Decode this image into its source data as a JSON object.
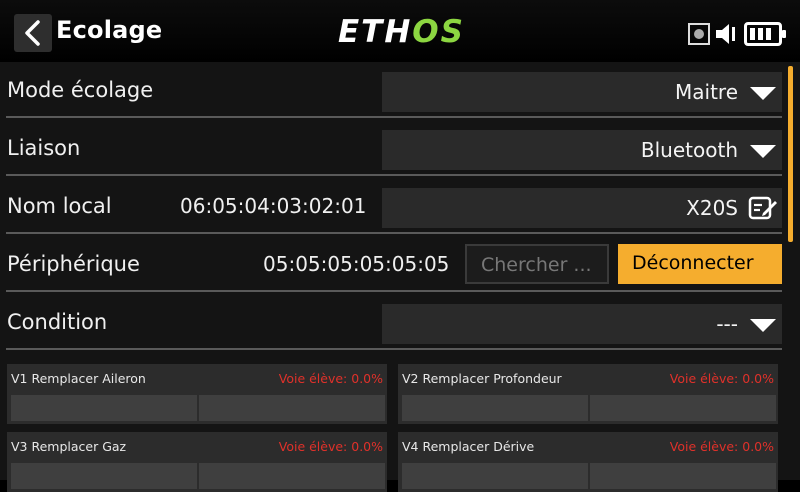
{
  "header": {
    "title": "Ecolage",
    "logo_part1": "ETH",
    "logo_part2": "OS"
  },
  "rows": {
    "mode": {
      "label": "Mode écolage",
      "value": "Maitre"
    },
    "link": {
      "label": "Liaison",
      "value": "Bluetooth"
    },
    "local_name": {
      "label": "Nom local",
      "address": "06:05:04:03:02:01",
      "value": "X20S"
    },
    "device": {
      "label": "Périphérique",
      "address": "05:05:05:05:05:05",
      "search_label": "Chercher ...",
      "disconnect_label": "Déconnecter"
    },
    "condition": {
      "label": "Condition",
      "value": "---"
    }
  },
  "channels": [
    {
      "label": "V1 Remplacer Aileron",
      "status": "Voie élève: 0.0%"
    },
    {
      "label": "V2 Remplacer Profondeur",
      "status": "Voie élève: 0.0%"
    },
    {
      "label": "V3 Remplacer Gaz",
      "status": "Voie élève: 0.0%"
    },
    {
      "label": "V4 Remplacer Dérive",
      "status": "Voie élève: 0.0%"
    }
  ],
  "colors": {
    "accent": "#f5ad2e",
    "logo_green": "#8cd641",
    "status_red": "#e0312a"
  },
  "icons": [
    "back-arrow-icon",
    "record-icon",
    "volume-icon",
    "battery-icon",
    "edit-icon",
    "chevron-down-icon"
  ]
}
